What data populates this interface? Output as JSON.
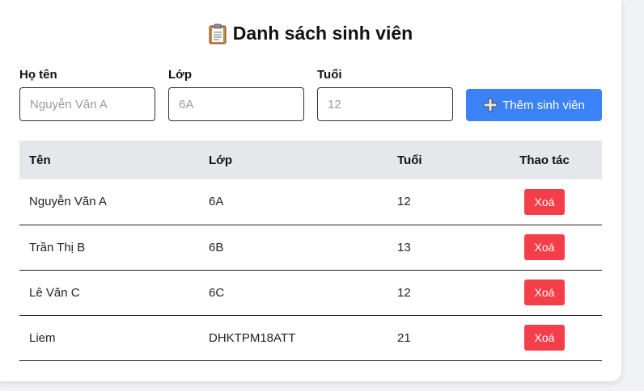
{
  "page": {
    "title": "Danh sách sinh viên",
    "title_icon": "clipboard-icon"
  },
  "form": {
    "name_label": "Họ tên",
    "name_placeholder": "Nguyễn Văn A",
    "class_label": "Lớp",
    "class_placeholder": "6A",
    "age_label": "Tuổi",
    "age_placeholder": "12",
    "add_button_label": "Thêm sinh viên",
    "add_button_icon": "plus-icon",
    "add_button_color": "#3b82f6"
  },
  "table": {
    "headers": [
      "Tên",
      "Lớp",
      "Tuổi",
      "Thao tác"
    ],
    "delete_label": "Xoá",
    "delete_color": "#f43f4a",
    "rows": [
      {
        "name": "Nguyễn Văn A",
        "class": "6A",
        "age": "12"
      },
      {
        "name": "Trần Thị B",
        "class": "6B",
        "age": "13"
      },
      {
        "name": "Lê Văn C",
        "class": "6C",
        "age": "12"
      },
      {
        "name": "Liem",
        "class": "DHKTPM18ATT",
        "age": "21"
      }
    ]
  }
}
